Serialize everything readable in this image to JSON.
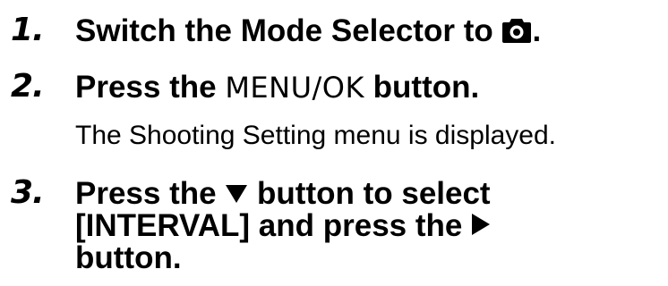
{
  "steps": [
    {
      "number": "1.",
      "text_before": "Switch the Mode Selector to ",
      "icon": "camera-icon",
      "text_after": "."
    },
    {
      "number": "2.",
      "text_before": "Press the ",
      "menu_label": "MENU/OK",
      "text_after": " button.",
      "description": "The Shooting Setting menu is displayed."
    },
    {
      "number": "3.",
      "line1_before": "Press the ",
      "icon_down": "down-triangle-icon",
      "line1_after": " button to select",
      "line2_before": "[INTERVAL] and press the ",
      "icon_right": "right-triangle-icon",
      "line3": "button."
    }
  ]
}
